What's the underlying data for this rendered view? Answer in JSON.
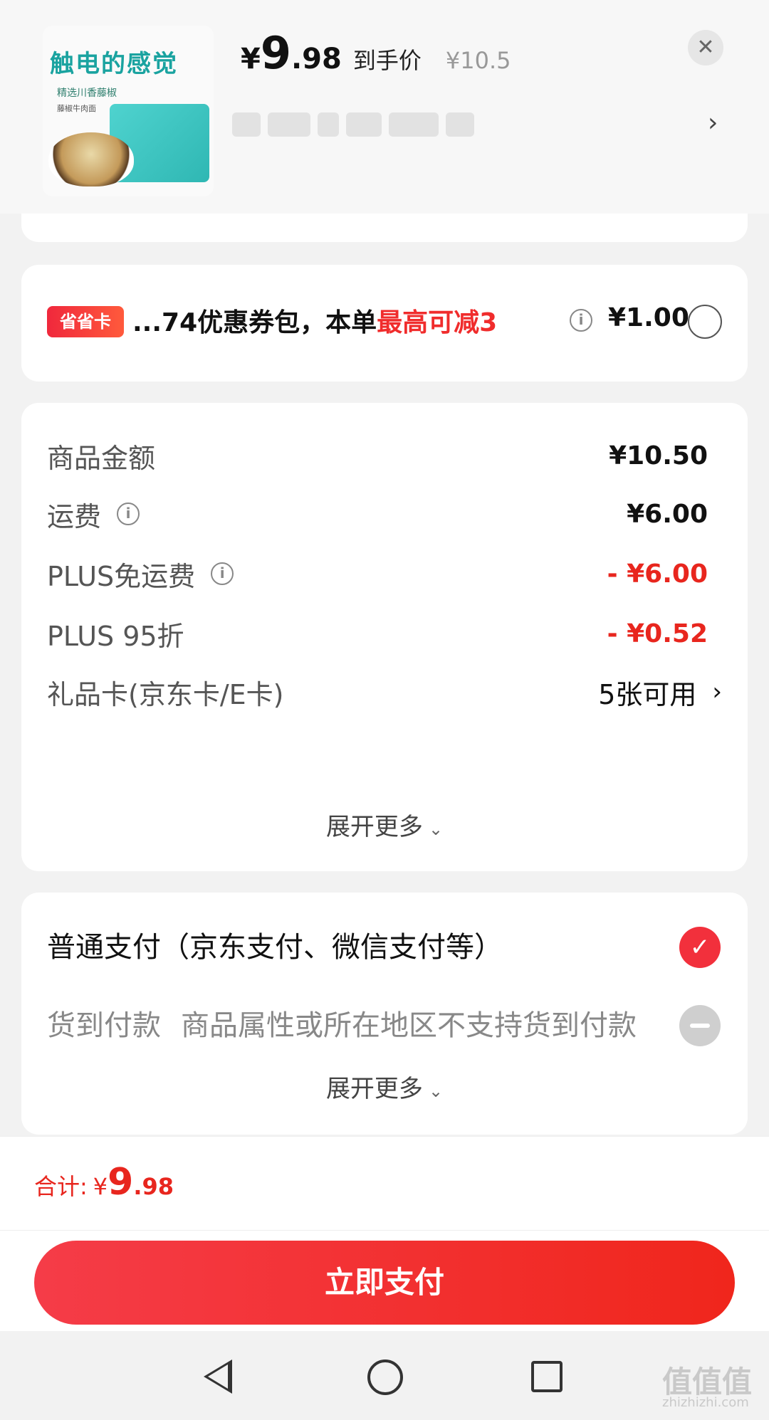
{
  "product": {
    "thumbnail": {
      "headline": "触电的感觉",
      "subline": "精选川香藤椒",
      "tag": "藤椒牛肉面"
    },
    "price_yen": "¥",
    "price_int": "9",
    "price_dec": ".98",
    "price_label": "到手价",
    "original_price": "¥10.5"
  },
  "coupon": {
    "badge": "省省卡",
    "text_prefix": "...74优惠券包，本单",
    "text_highlight": "最高可减3",
    "amount": "¥1.00",
    "selected": false
  },
  "summary": {
    "rows": [
      {
        "label": "商品金额",
        "value": "¥10.50"
      },
      {
        "label": "运费",
        "value": "¥6.00"
      },
      {
        "label": "PLUS免运费",
        "value": "- ¥6.00"
      },
      {
        "label": "PLUS 95折",
        "value": "- ¥0.52"
      },
      {
        "label": "礼品卡(京东卡/E卡)",
        "value": "5张可用"
      }
    ],
    "expand_label": "展开更多"
  },
  "payment": {
    "normal_label": "普通支付（京东支付、微信支付等）",
    "cod_label": "货到付款",
    "cod_reason": "商品属性或所在地区不支持货到付款",
    "expand_label": "展开更多"
  },
  "total": {
    "label": "合计:",
    "yen": "¥",
    "int": "9",
    "dec": ".98"
  },
  "pay_button": "立即支付",
  "colors": {
    "accent_red": "#e8261e",
    "button_red": "#f2303c"
  },
  "icons": {
    "close": "close-icon",
    "chevron": "chevron-right-icon",
    "info": "info-icon",
    "check": "check-icon",
    "disabled": "minus-circle-icon"
  },
  "watermark": {
    "main": "值值值",
    "sub": "zhizhizhi.com"
  }
}
